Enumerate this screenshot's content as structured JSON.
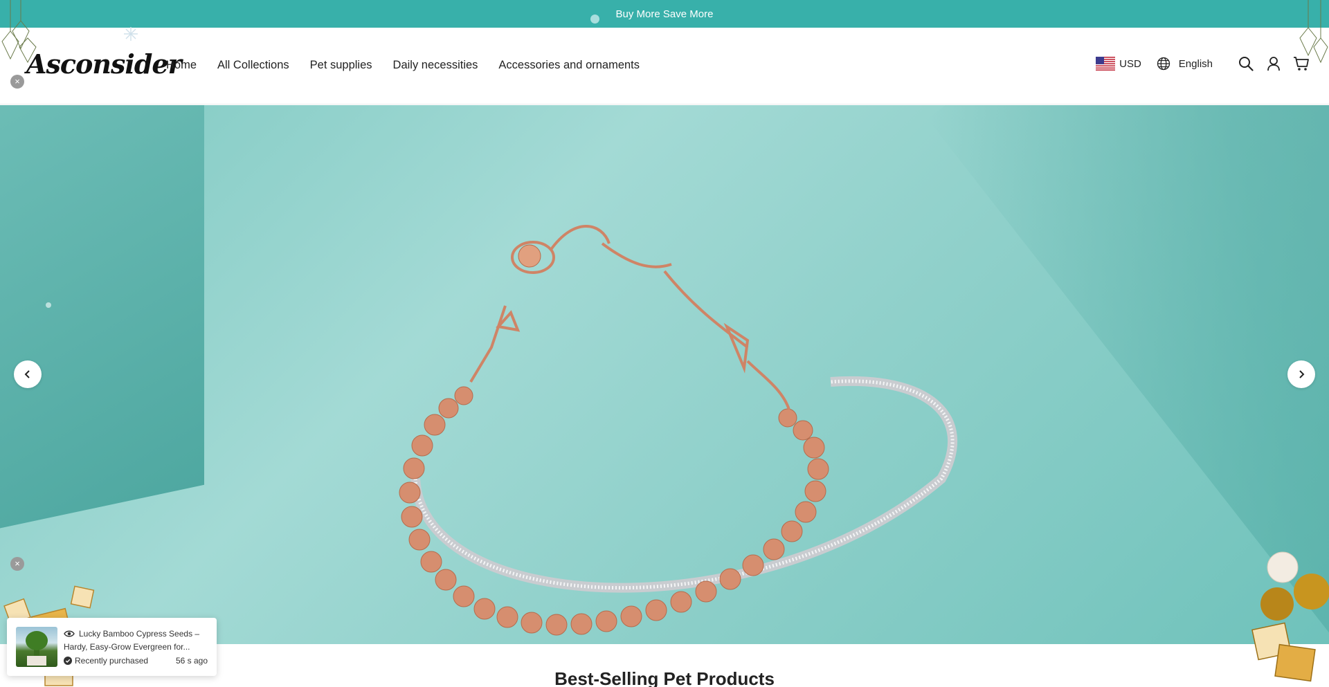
{
  "announcement": {
    "text": "Buy More Save More"
  },
  "header": {
    "logo": "Asconsider",
    "nav": [
      "Home",
      "All Collections",
      "Pet supplies",
      "Daily necessities",
      "Accessories and ornaments"
    ],
    "currency": "USD",
    "language": "English",
    "icons": [
      "search-icon",
      "account-icon",
      "cart-icon"
    ]
  },
  "hero": {
    "prev_icon": "chevron-left-icon",
    "next_icon": "chevron-right-icon"
  },
  "section": {
    "title": "Best-Selling Pet Products"
  },
  "popup": {
    "product": "Lucky Bamboo Cypress Seeds – Hardy, Easy-Grow Evergreen for...",
    "status": "Recently purchased",
    "time": "56 s ago"
  },
  "colors": {
    "accent": "#38b0aa",
    "hero_bg": "#8fd0ca"
  }
}
